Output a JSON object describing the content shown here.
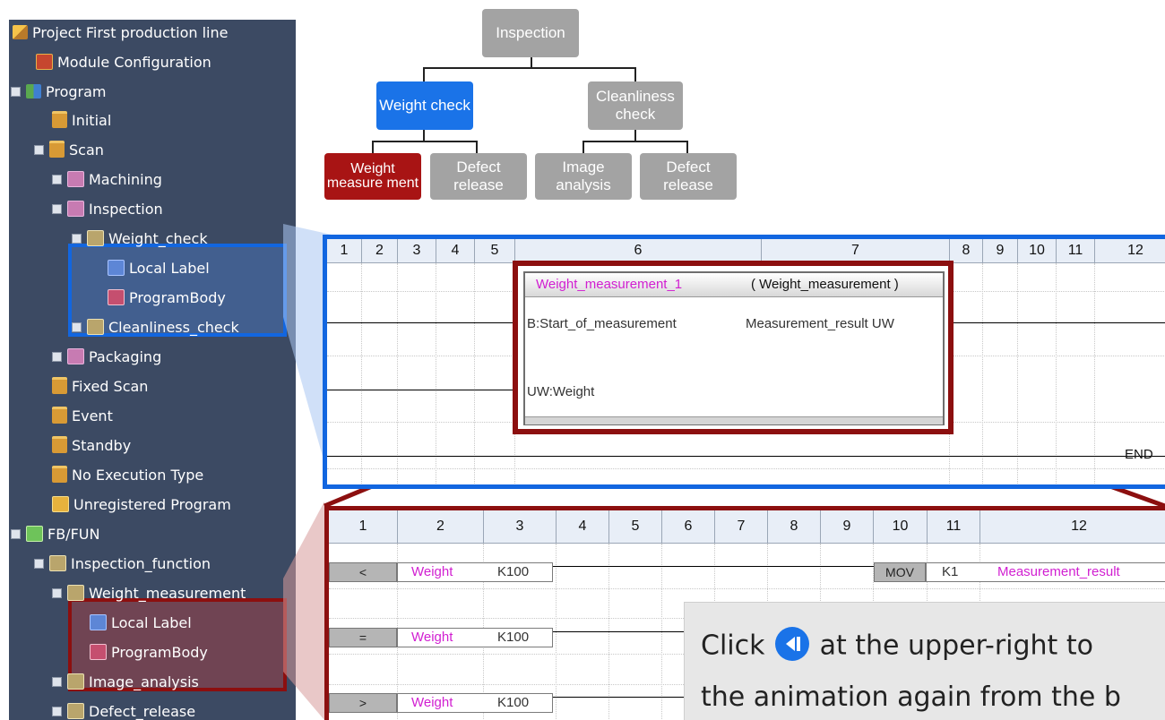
{
  "sidebar": {
    "items": [
      {
        "label": "Project First production line",
        "icon": "project-icon"
      },
      {
        "label": "Module Configuration",
        "icon": "module-configuration-icon"
      },
      {
        "label": "Program",
        "icon": "program-icon"
      },
      {
        "label": "Initial",
        "icon": "folder-icon"
      },
      {
        "label": "Scan",
        "icon": "folder-icon"
      },
      {
        "label": "Machining",
        "icon": "task-icon"
      },
      {
        "label": "Inspection",
        "icon": "task-icon"
      },
      {
        "label": "Weight_check",
        "icon": "program-block-icon"
      },
      {
        "label": "Local Label",
        "icon": "local-label-icon"
      },
      {
        "label": "ProgramBody",
        "icon": "program-body-icon"
      },
      {
        "label": "Cleanliness_check",
        "icon": "program-block-icon"
      },
      {
        "label": "Packaging",
        "icon": "task-icon"
      },
      {
        "label": "Fixed Scan",
        "icon": "folder-icon"
      },
      {
        "label": "Event",
        "icon": "folder-icon"
      },
      {
        "label": "Standby",
        "icon": "folder-icon"
      },
      {
        "label": "No Execution Type",
        "icon": "folder-icon"
      },
      {
        "label": "Unregistered Program",
        "icon": "unregistered-icon"
      },
      {
        "label": "FB/FUN",
        "icon": "fb-fun-icon"
      },
      {
        "label": "Inspection_function",
        "icon": "fb-folder-icon"
      },
      {
        "label": "Weight_measurement",
        "icon": "fb-folder-icon"
      },
      {
        "label": "Local Label",
        "icon": "local-label-icon"
      },
      {
        "label": "ProgramBody",
        "icon": "program-body-icon"
      },
      {
        "label": "Image_analysis",
        "icon": "fb-folder-icon"
      },
      {
        "label": "Defect_release",
        "icon": "fb-folder-icon"
      }
    ]
  },
  "diagram": {
    "root": "Inspection",
    "weight_check": "Weight check",
    "cleanliness_check": "Cleanliness check",
    "weight_measurement": "Weight measure ment",
    "defect_release_1": "Defect release",
    "image_analysis": "Image analysis",
    "defect_release_2": "Defect release"
  },
  "upper_ladder": {
    "columns": [
      "1",
      "2",
      "3",
      "4",
      "5",
      "6",
      "7",
      "8",
      "9",
      "10",
      "11",
      "12"
    ],
    "fb_instance": "Weight_measurement_1",
    "fb_type": "( Weight_measurement )",
    "input_1": "B:Start_of_measurement",
    "output_1": "Measurement_result UW",
    "input_2": "UW:Weight",
    "end_label": "END"
  },
  "lower_ladder": {
    "columns": [
      "1",
      "2",
      "3",
      "4",
      "5",
      "6",
      "7",
      "8",
      "9",
      "10",
      "11",
      "12"
    ],
    "rows": [
      {
        "op": "<",
        "var": "Weight",
        "const": "K100"
      },
      {
        "op": "=",
        "var": "Weight",
        "const": "K100"
      },
      {
        "op": ">",
        "var": "Weight",
        "const": "K100"
      }
    ],
    "mov": "MOV",
    "mov_src": "K1",
    "mov_dst": "Measurement_result"
  },
  "tooltip": {
    "before_icon": "Click",
    "after_icon": "at the upper-right to",
    "line2": "the animation again from the b"
  },
  "colors": {
    "sidebar_bg": "#3c4a63",
    "accent_blue": "#1a73e8",
    "accent_red": "#a81414",
    "box_gray": "#a3a3a3",
    "variable_magenta": "#d11fd1"
  }
}
